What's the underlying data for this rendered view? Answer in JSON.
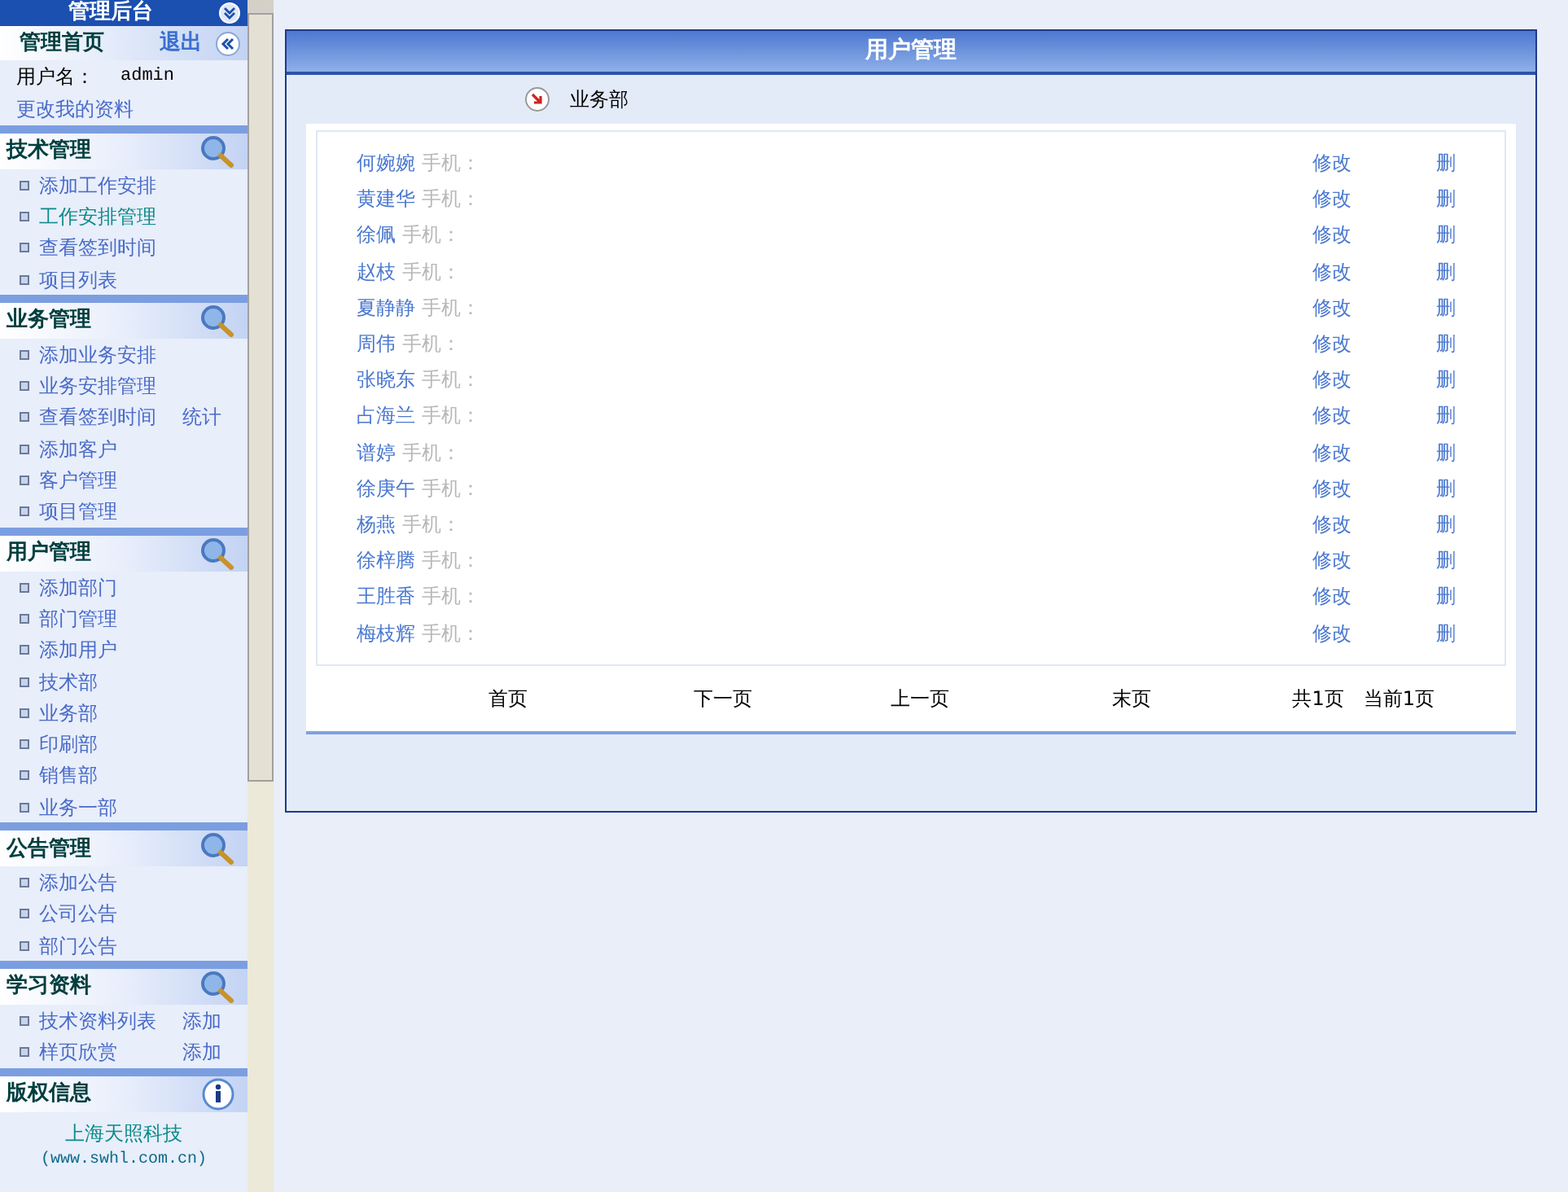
{
  "sidebar": {
    "title": "管理后台",
    "home": "管理首页",
    "logout": "退出",
    "username_label": "用户名：",
    "username": "admin",
    "profile_link": "更改我的资料",
    "sections": [
      {
        "title": "技术管理",
        "kind": "search",
        "items": [
          {
            "label": "添加工作安排",
            "selected": false
          },
          {
            "label": "工作安排管理",
            "selected": true
          },
          {
            "label": "查看签到时间",
            "selected": false
          },
          {
            "label": "项目列表",
            "selected": false
          }
        ]
      },
      {
        "title": "业务管理",
        "kind": "search",
        "items": [
          {
            "label": "添加业务安排",
            "selected": false
          },
          {
            "label": "业务安排管理",
            "selected": false
          },
          {
            "label": "查看签到时间",
            "extra": "统计",
            "selected": false
          },
          {
            "label": "添加客户",
            "selected": false
          },
          {
            "label": "客户管理",
            "selected": false
          },
          {
            "label": "项目管理",
            "selected": false
          }
        ]
      },
      {
        "title": "用户管理",
        "kind": "search",
        "items": [
          {
            "label": "添加部门",
            "selected": false
          },
          {
            "label": "部门管理",
            "selected": false
          },
          {
            "label": "添加用户",
            "selected": false
          },
          {
            "label": "技术部",
            "selected": false
          },
          {
            "label": "业务部",
            "selected": false
          },
          {
            "label": "印刷部",
            "selected": false
          },
          {
            "label": "销售部",
            "selected": false
          },
          {
            "label": "业务一部",
            "selected": false
          }
        ]
      },
      {
        "title": "公告管理",
        "kind": "search",
        "items": [
          {
            "label": "添加公告",
            "selected": false
          },
          {
            "label": "公司公告",
            "selected": false
          },
          {
            "label": "部门公告",
            "selected": false
          }
        ]
      },
      {
        "title": "学习资料",
        "kind": "search",
        "items": [
          {
            "label": "技术资料列表",
            "extra": "添加",
            "selected": false
          },
          {
            "label": "样页欣赏",
            "extra": "添加",
            "selected": false
          }
        ]
      },
      {
        "title": "版权信息",
        "kind": "info"
      }
    ],
    "company": "上海天照科技",
    "website": "(www.swhl.com.cn)"
  },
  "panel": {
    "title": "用户管理",
    "department": "业务部",
    "rows": [
      {
        "name": "何婉婉",
        "phone_label": "手机：",
        "edit": "修改",
        "delete": "删"
      },
      {
        "name": "黄建华",
        "phone_label": "手机：",
        "edit": "修改",
        "delete": "删"
      },
      {
        "name": "徐佩",
        "phone_label": "手机：",
        "edit": "修改",
        "delete": "删"
      },
      {
        "name": "赵枝",
        "phone_label": "手机：",
        "edit": "修改",
        "delete": "删"
      },
      {
        "name": "夏静静",
        "phone_label": "手机：",
        "edit": "修改",
        "delete": "删"
      },
      {
        "name": "周伟",
        "phone_label": "手机：",
        "edit": "修改",
        "delete": "删"
      },
      {
        "name": "张晓东",
        "phone_label": "手机：",
        "edit": "修改",
        "delete": "删"
      },
      {
        "name": "占海兰",
        "phone_label": "手机：",
        "edit": "修改",
        "delete": "删"
      },
      {
        "name": "谱婷",
        "phone_label": "手机：",
        "edit": "修改",
        "delete": "删"
      },
      {
        "name": "徐庚午",
        "phone_label": "手机：",
        "edit": "修改",
        "delete": "删"
      },
      {
        "name": "杨燕",
        "phone_label": "手机：",
        "edit": "修改",
        "delete": "删"
      },
      {
        "name": "徐梓腾",
        "phone_label": "手机：",
        "edit": "修改",
        "delete": "删"
      },
      {
        "name": "王胜香",
        "phone_label": "手机：",
        "edit": "修改",
        "delete": "删"
      },
      {
        "name": "梅枝辉",
        "phone_label": "手机：",
        "edit": "修改",
        "delete": "删"
      }
    ],
    "pagination": {
      "first": "首页",
      "next": "下一页",
      "prev": "上一页",
      "last": "末页",
      "total": "共1页",
      "current": "当前1页"
    }
  }
}
